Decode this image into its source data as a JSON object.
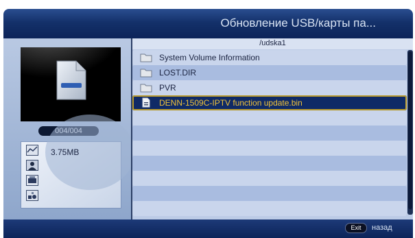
{
  "header": {
    "title": "Обновление USB/карты па..."
  },
  "preview": {
    "counter": "004/004",
    "file_size": "3.75MB"
  },
  "browser": {
    "path": "/udska1",
    "items": [
      {
        "name": "System Volume Information",
        "type": "folder"
      },
      {
        "name": "LOST.DIR",
        "type": "folder"
      },
      {
        "name": "PVR",
        "type": "folder"
      },
      {
        "name": "DENN-1509C-IPTV function update.bin",
        "type": "file",
        "selected": true
      }
    ]
  },
  "footer": {
    "exit_key": "Exit",
    "exit_label": "назад"
  },
  "colors": {
    "selected_text": "#f0c23a",
    "selected_border": "#b79a2e",
    "header_bg": "#14316a"
  }
}
